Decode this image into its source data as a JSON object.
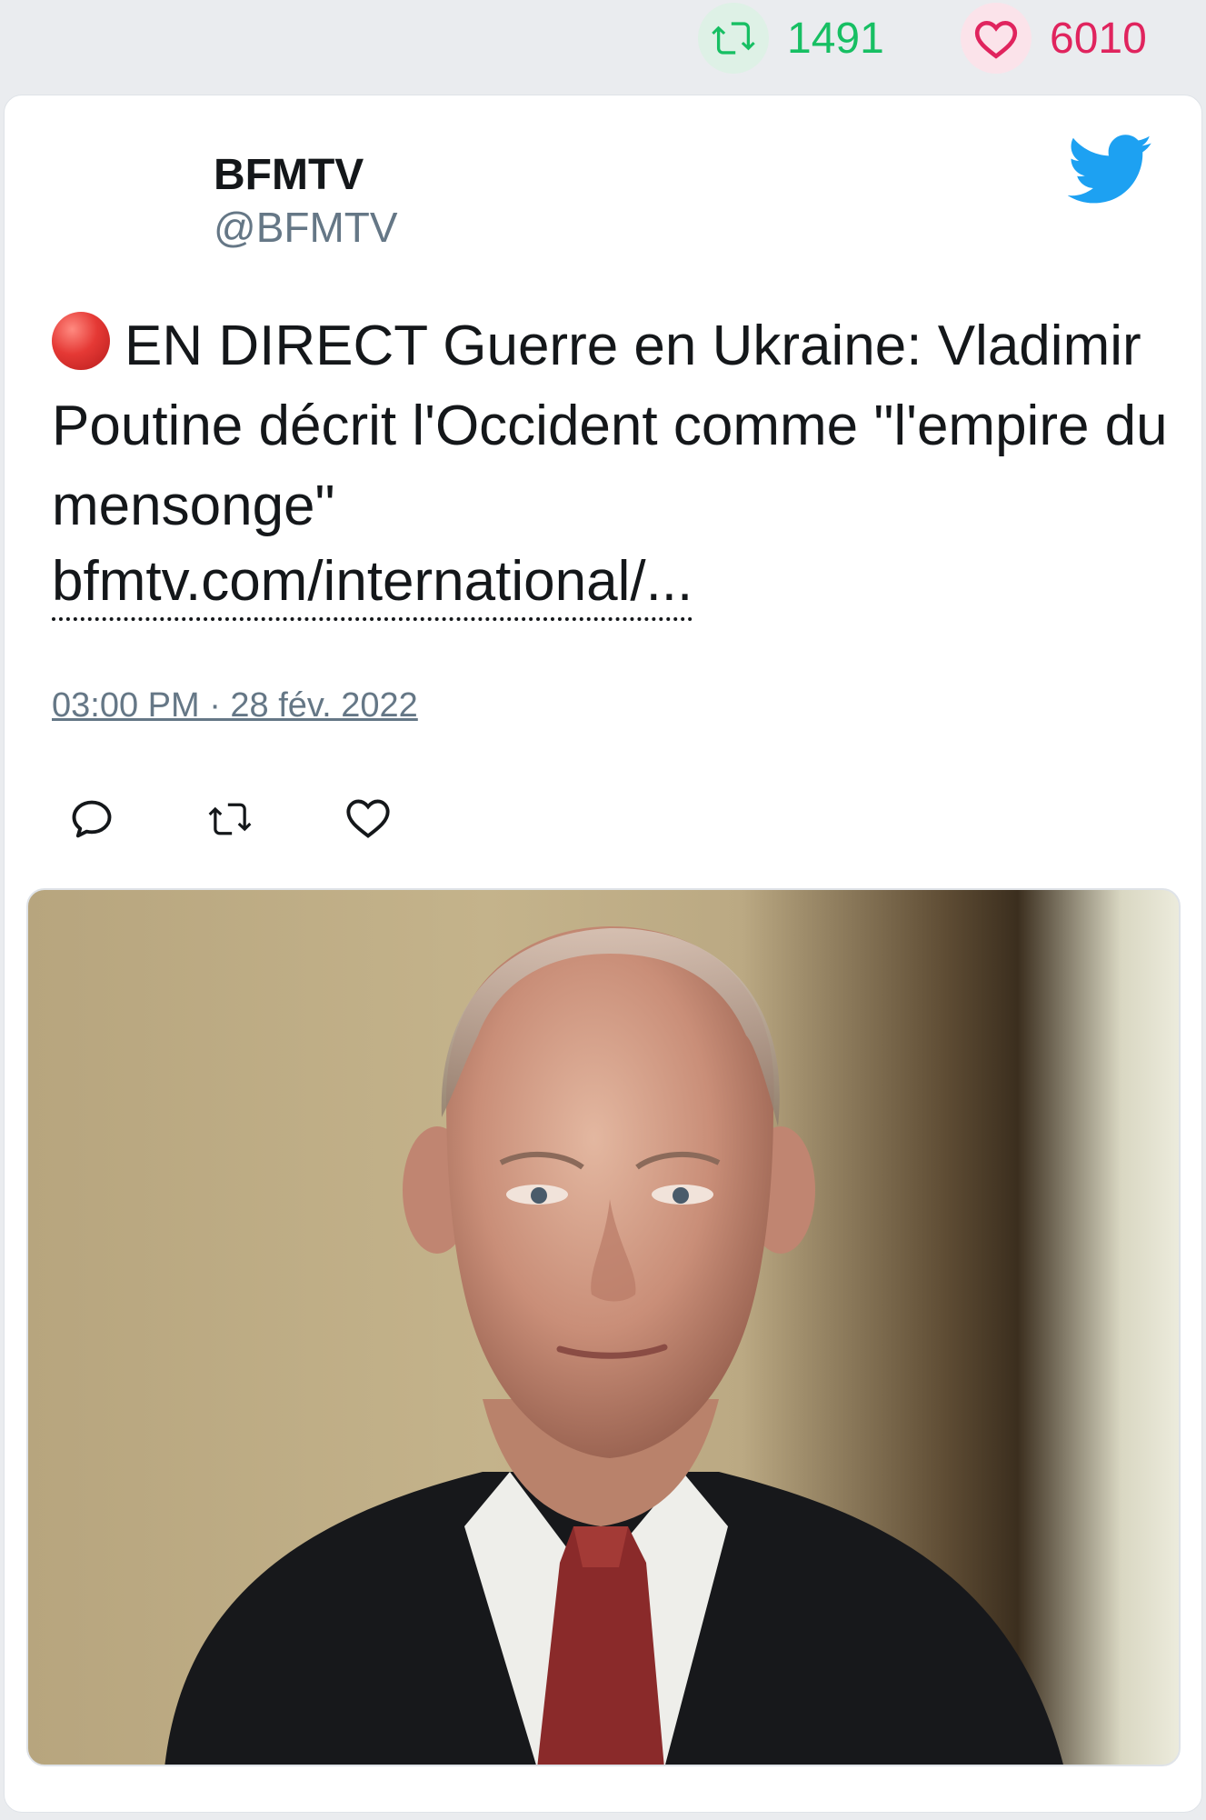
{
  "top_stats": {
    "retweets": "1491",
    "likes": "6010",
    "retweet_icon": "retweet-icon",
    "like_icon": "heart-icon",
    "retweet_color": "#17bf63",
    "like_color": "#e0245e"
  },
  "tweet": {
    "author_name": "BFMTV",
    "author_handle": "@BFMTV",
    "live_icon": "red-circle-icon",
    "text": "EN DIRECT Guerre en Ukraine: Vladimir Poutine décrit l'Occident comme \"l'empire du mensonge\"",
    "link": "bfmtv.com/international/...",
    "timestamp": "03:00 PM · 28 fév. 2022",
    "platform_icon": "twitter-bird-icon",
    "brand_color": "#1da1f2"
  },
  "actions": [
    {
      "icon": "reply-icon"
    },
    {
      "icon": "retweet-icon"
    },
    {
      "icon": "like-icon"
    }
  ],
  "media": {
    "description_icon": "photo-of-man-in-suit"
  }
}
